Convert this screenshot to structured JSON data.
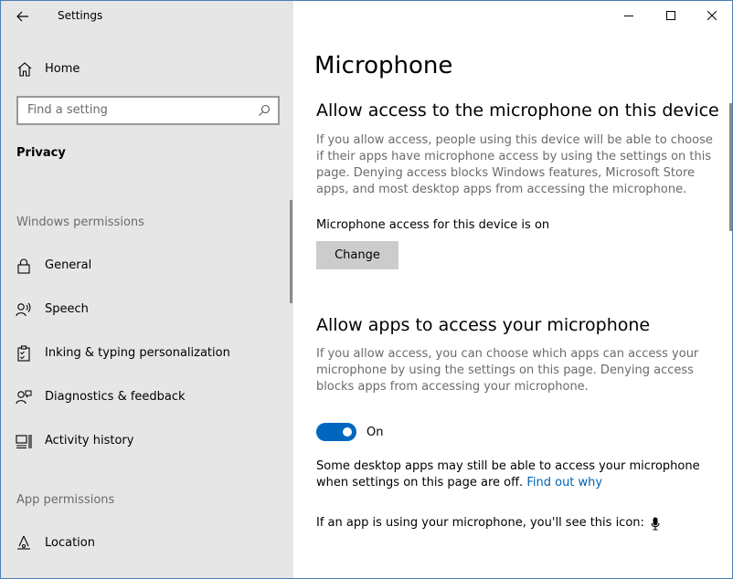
{
  "window": {
    "title": "Settings",
    "controls": [
      "minimize",
      "maximize",
      "close"
    ]
  },
  "sidebar": {
    "home_label": "Home",
    "search_placeholder": "Find a setting",
    "section": "Privacy",
    "windows_permissions_header": "Windows permissions",
    "windows_items": [
      {
        "label": "General",
        "icon": "lock-icon"
      },
      {
        "label": "Speech",
        "icon": "speech-icon"
      },
      {
        "label": "Inking & typing personalization",
        "icon": "clipboard-icon"
      },
      {
        "label": "Diagnostics & feedback",
        "icon": "feedback-icon"
      },
      {
        "label": "Activity history",
        "icon": "activity-history-icon"
      }
    ],
    "app_permissions_header": "App permissions",
    "app_items": [
      {
        "label": "Location",
        "icon": "location-icon"
      }
    ]
  },
  "main": {
    "title": "Microphone",
    "device_section": {
      "heading": "Allow access to the microphone on this device",
      "description": "If you allow access, people using this device will be able to choose if their apps have microphone access by using the settings on this page. Denying access blocks Windows features, Microsoft Store apps, and most desktop apps from accessing the microphone.",
      "status": "Microphone access for this device is on",
      "change_label": "Change"
    },
    "apps_section": {
      "heading": "Allow apps to access your microphone",
      "description": "If you allow access, you can choose which apps can access your microphone by using the settings on this page. Denying access blocks apps from accessing your microphone.",
      "toggle_state": "On",
      "toggle_on": true,
      "note": "Some desktop apps may still be able to access your microphone when settings on this page are off.",
      "link": "Find out why",
      "icon_note": "If an app is using your microphone, you'll see this icon:"
    }
  },
  "colors": {
    "sidebar_bg": "#e6e6e6",
    "accent": "#0067c0",
    "link": "#0063b1",
    "button_bg": "#cccccc",
    "secondary_text": "#6b6b6b"
  }
}
